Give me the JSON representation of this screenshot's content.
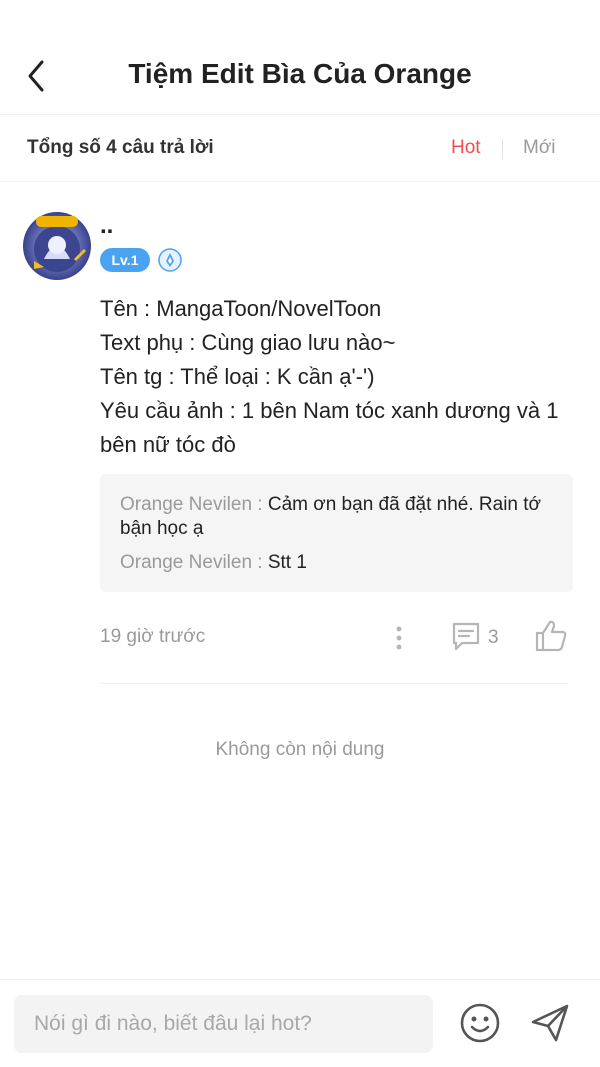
{
  "header": {
    "title": "Tiệm Edit Bìa Của Orange",
    "back_icon": "chevron-left-icon"
  },
  "summary": {
    "count_text": "Tổng số 4 câu trả lời",
    "sort_options": [
      "Hot",
      "Mới"
    ],
    "active_sort": "Hot",
    "active_color": "#f0504d"
  },
  "post": {
    "username": "..",
    "level": "Lv.1",
    "avatar_badge_text": "WRITER",
    "lines": [
      "Tên : MangaToon/NovelToon",
      "Text phụ : Cùng giao lưu nào~",
      "Tên tg : Thể loại : K cần ạ'-')",
      "Yêu cầu ảnh : 1 bên Nam tóc xanh dương và 1",
      "bên nữ tóc đò"
    ],
    "replies": [
      {
        "author": "Orange Nevilen : ",
        "text": "Cảm ơn bạn đã đặt nhé. Rain tớ bận học ạ"
      },
      {
        "author": "Orange Nevilen : ",
        "text": "Stt 1"
      }
    ],
    "time": "19 giờ trước",
    "comment_count": "3"
  },
  "end_text": "Không còn nội dung",
  "composer": {
    "placeholder": "Nói gì đi nào, biết đâu lại hot?"
  }
}
